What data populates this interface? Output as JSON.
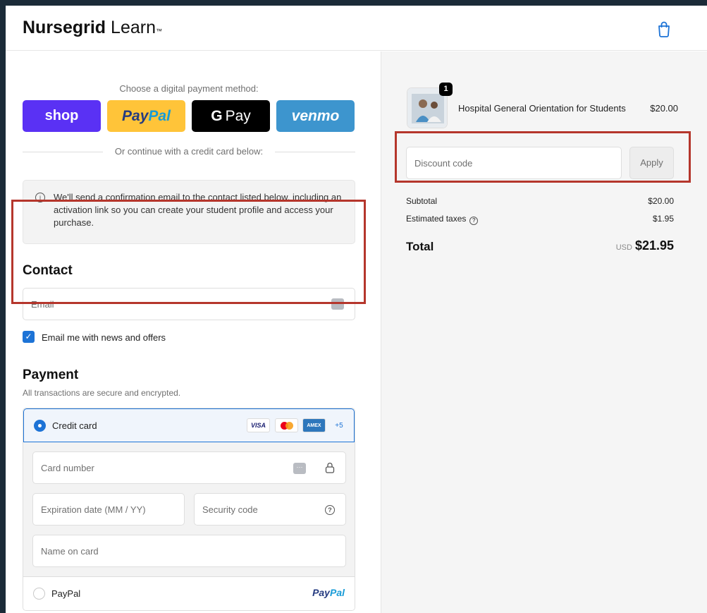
{
  "header": {
    "brand_bold": "Nursegrid",
    "brand_light": "Learn",
    "brand_tm": "™",
    "cart_icon": "shopping-bag-icon"
  },
  "express": {
    "prompt": "Choose a digital payment method:",
    "buttons": {
      "shop": "shop",
      "paypal_a": "Pay",
      "paypal_b": "Pal",
      "gpay_g": "G",
      "gpay_text": "Pay",
      "venmo": "venmo"
    },
    "divider": "Or continue with a credit card below:"
  },
  "notice": {
    "icon": "info-icon",
    "text": "We'll send a confirmation email to the contact listed below, including an activation link so you can create your student profile and access your purchase."
  },
  "contact": {
    "heading": "Contact",
    "email_placeholder": "Email",
    "newsletter_label": "Email me with news and offers",
    "newsletter_checked": true
  },
  "payment": {
    "heading": "Payment",
    "subtext": "All transactions are secure and encrypted.",
    "credit_card": {
      "label": "Credit card",
      "selected": true,
      "badges": {
        "visa": "VISA",
        "amex": "AMEX",
        "more": "+5"
      },
      "card_number_placeholder": "Card number",
      "expiration_placeholder": "Expiration date (MM / YY)",
      "security_placeholder": "Security code",
      "name_placeholder": "Name on card"
    },
    "paypal": {
      "label": "PayPal",
      "selected": false,
      "logo_a": "Pay",
      "logo_b": "Pal"
    }
  },
  "summary": {
    "item": {
      "quantity": "1",
      "name": "Hospital General Orientation for Students",
      "price": "$20.00"
    },
    "discount_placeholder": "Discount code",
    "apply_label": "Apply",
    "subtotal_label": "Subtotal",
    "subtotal_value": "$20.00",
    "taxes_label": "Estimated taxes",
    "taxes_value": "$1.95",
    "total_label": "Total",
    "total_currency": "USD",
    "total_value": "$21.95"
  },
  "colors": {
    "accent": "#1d73d6",
    "highlight": "#b5362c",
    "shop": "#5a31f4",
    "paypal": "#ffc439",
    "venmo": "#3d95ce"
  }
}
